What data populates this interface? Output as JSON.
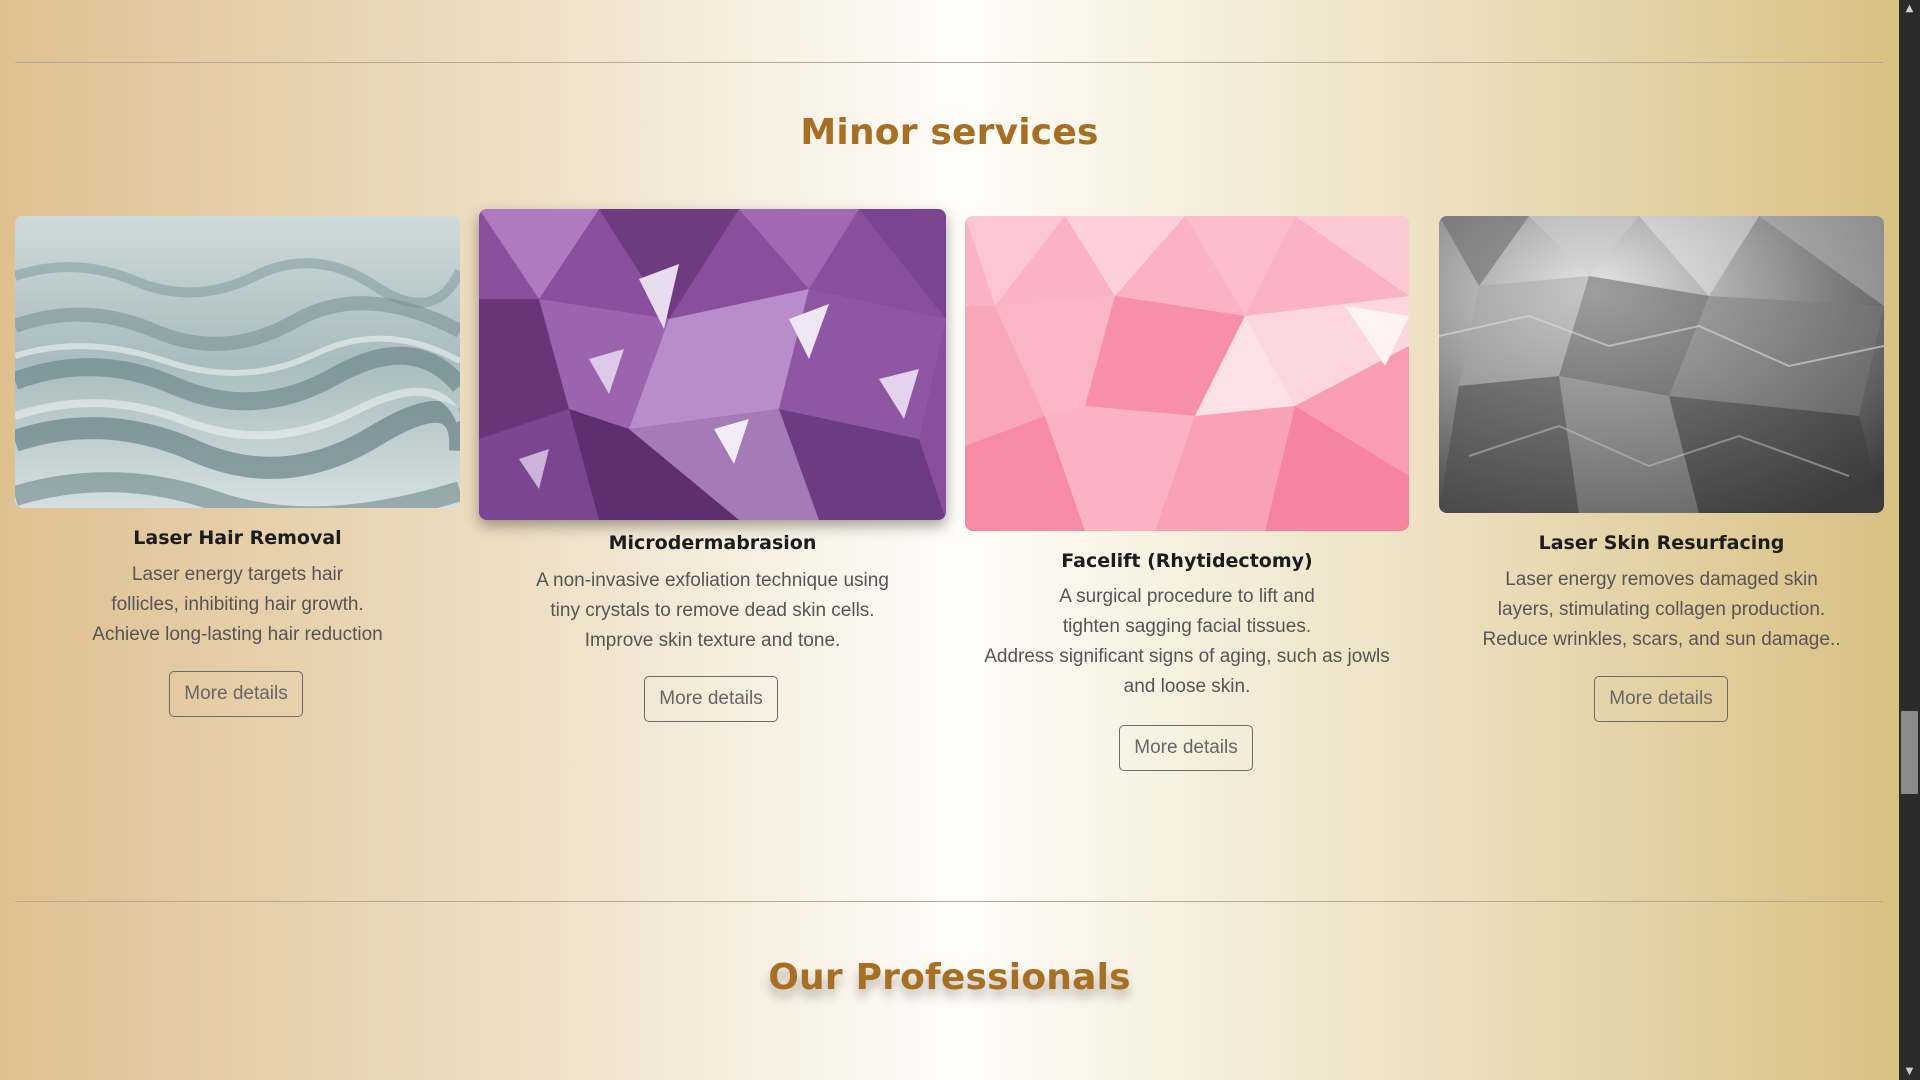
{
  "sections": {
    "minor_title": "Minor services",
    "professionals_title": "Our Professionals"
  },
  "cards": [
    {
      "name": "Laser Hair Removal",
      "desc": [
        "Laser energy targets hair",
        "follicles, inhibiting hair growth.",
        "Achieve long-lasting hair reduction"
      ],
      "button": "More details",
      "image": "sand-dunes-image"
    },
    {
      "name": "Microdermabrasion",
      "desc": [
        "A non-invasive exfoliation technique using",
        "tiny crystals to remove dead skin cells.",
        "Improve skin texture and tone."
      ],
      "button": "More details",
      "image": "amethyst-crystals-image"
    },
    {
      "name": "Facelift (Rhytidectomy)",
      "desc": [
        "A surgical procedure to lift and",
        "tighten sagging facial tissues.",
        "Address significant signs of aging, such as jowls",
        "and loose skin."
      ],
      "button": "More details",
      "image": "pink-polygon-image"
    },
    {
      "name": "Laser Skin Resurfacing",
      "desc": [
        "Laser energy removes damaged skin",
        "layers, stimulating collagen production.",
        "Reduce wrinkles, scars, and sun damage.."
      ],
      "button": "More details",
      "image": "crumpled-paper-image"
    }
  ],
  "colors": {
    "accent": "#a66f24",
    "text_dark": "#1c1c1c",
    "text_muted": "#555555"
  }
}
